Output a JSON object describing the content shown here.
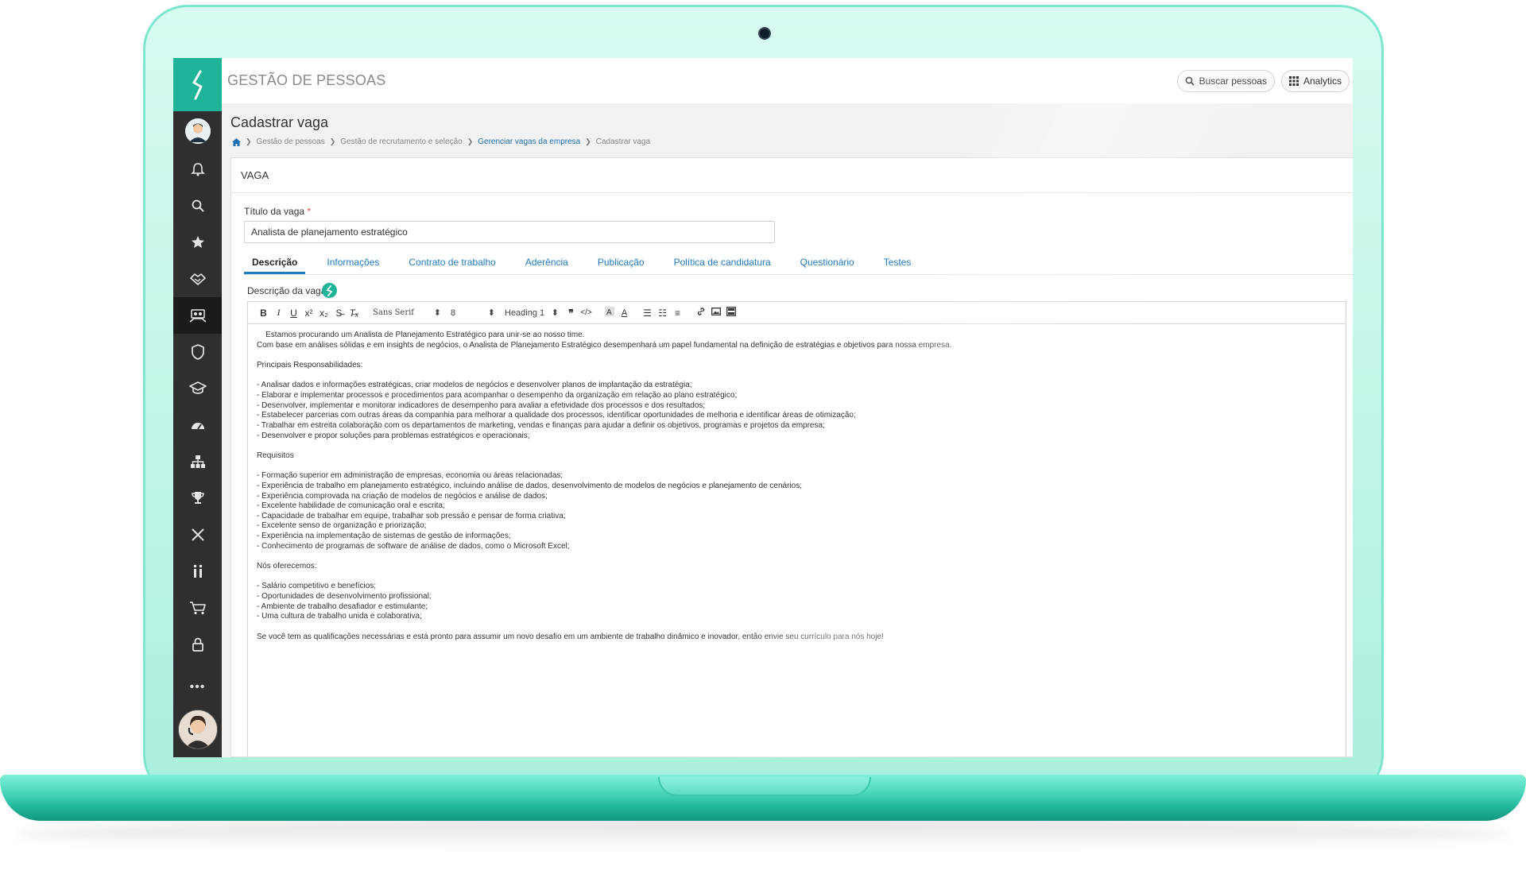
{
  "app": {
    "title": "GESTÃO DE PESSOAS"
  },
  "header": {
    "search_label": "Buscar pessoas",
    "analytics_label": "Analytics"
  },
  "page": {
    "title": "Cadastrar vaga"
  },
  "breadcrumb": {
    "items": [
      "Gestão de pessoas",
      "Gestão de recrutamento e seleção",
      "Gerenciar vagas da empresa",
      "Cadastrar vaga"
    ]
  },
  "card": {
    "section_title": "VAGA"
  },
  "form": {
    "title_label": "Título da vaga",
    "required_mark": "*",
    "title_value": "Analista de planejamento estratégico",
    "description_label": "Descrição da vaga"
  },
  "tabs": [
    "Descrição",
    "Informações",
    "Contrato de trabalho",
    "Aderência",
    "Publicação",
    "Política de candidatura",
    "Questionário",
    "Testes"
  ],
  "toolbar": {
    "font": "Sans Serif",
    "size": "8",
    "heading": "Heading 1"
  },
  "editor": {
    "content": "    Estamos procurando um Analista de Planejamento Estratégico para unir-se ao nosso time.\nCom base em análises sólidas e em insights de negócios, o Analista de Planejamento Estratégico desempenhará um papel fundamental na definição de estratégias e objetivos para nossa empresa.\n\nPrincipais Responsabilidades:\n\n- Analisar dados e informações estratégicas, criar modelos de negócios e desenvolver planos de implantação da estratégia;\n- Elaborar e implementar processos e procedimentos para acompanhar o desempenho da organização em relação ao plano estratégico;\n- Desenvolver, implementar e monitorar indicadores de desempenho para avaliar a efetividade dos processos e dos resultados;\n- Estabelecer parcerias com outras áreas da companhia para melhorar a qualidade dos processos, identificar oportunidades de melhoria e identificar áreas de otimização;\n- Trabalhar em estreita colaboração com os departamentos de marketing, vendas e finanças para ajudar a definir os objetivos, programas e projetos da empresa;\n- Desenvolver e propor soluções para problemas estratégicos e operacionais;\n\nRequisitos\n\n- Formação superior em administração de empresas, economia ou áreas relacionadas;\n- Experiência de trabalho em planejamento estratégico, incluindo análise de dados, desenvolvimento de modelos de negócios e planejamento de cenários;\n- Experiência comprovada na criação de modelos de negócios e análise de dados;\n- Excelente habilidade de comunicação oral e escrita;\n- Capacidade de trabalhar em equipe, trabalhar sob pressão e pensar de forma criativa;\n- Excelente senso de organização e priorização;\n- Experiência na implementação de sistemas de gestão de informações;\n- Conhecimento de programas de software de análise de dados, como o Microsoft Excel;\n\nNós oferecemos:\n\n- Salário competitivo e benefícios;\n- Oportunidades de desenvolvimento profissional;\n- Ambiente de trabalho desafiador e estimulante;\n- Uma cultura de trabalho unida e colaborativa;\n\nSe você tem as qualificações necessárias e está pronto para assumir um novo desafio em um ambiente de trabalho dinâmico e inovador, então envie seu currículo para nós hoje!"
  },
  "colors": {
    "brand": "#1fb39a",
    "sidebar": "#2f2f2f",
    "link": "#1f7bbf",
    "laptop": "#bff4e6"
  }
}
